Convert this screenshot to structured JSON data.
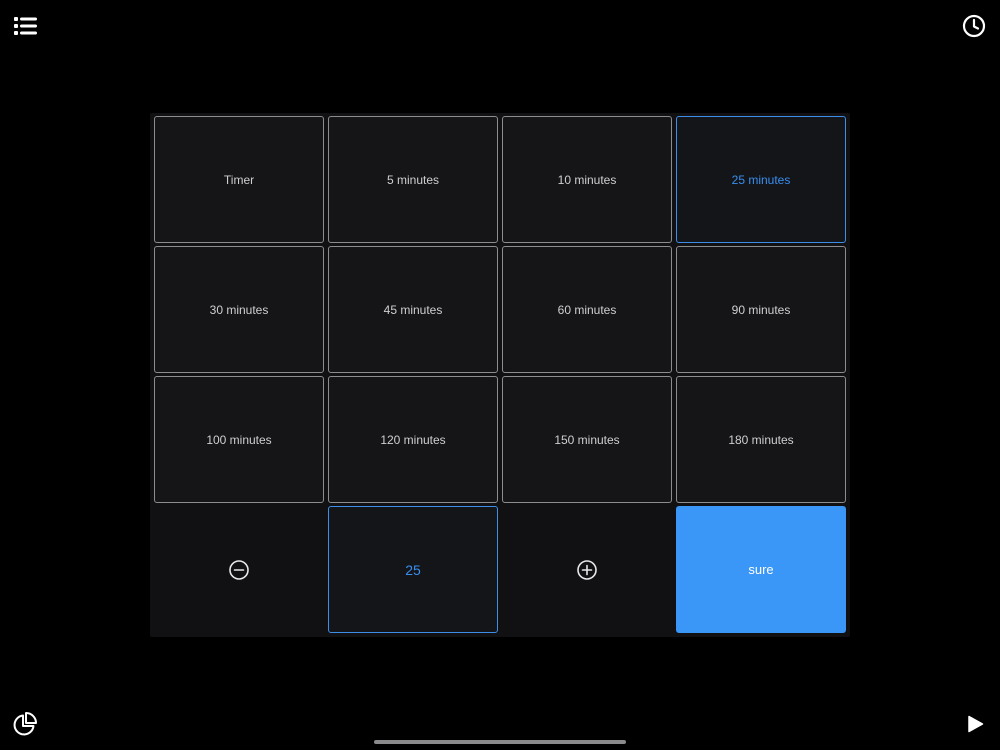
{
  "toolbar": {
    "menu_icon": "list-icon",
    "history_icon": "clock-icon",
    "stats_icon": "pie-chart-icon",
    "play_icon": "play-icon"
  },
  "presets": [
    {
      "label": "Timer",
      "selected": false
    },
    {
      "label": "5 minutes",
      "selected": false
    },
    {
      "label": "10 minutes",
      "selected": false
    },
    {
      "label": "25 minutes",
      "selected": true
    },
    {
      "label": "30 minutes",
      "selected": false
    },
    {
      "label": "45 minutes",
      "selected": false
    },
    {
      "label": "60 minutes",
      "selected": false
    },
    {
      "label": "90 minutes",
      "selected": false
    },
    {
      "label": "100 minutes",
      "selected": false
    },
    {
      "label": "120 minutes",
      "selected": false
    },
    {
      "label": "150 minutes",
      "selected": false
    },
    {
      "label": "180 minutes",
      "selected": false
    }
  ],
  "stepper": {
    "decrement_icon": "minus-circle-icon",
    "value": "25",
    "increment_icon": "plus-circle-icon"
  },
  "confirm": {
    "label": "sure"
  },
  "colors": {
    "accent": "#3a96f7",
    "background": "#000000",
    "panel": "#111113"
  }
}
